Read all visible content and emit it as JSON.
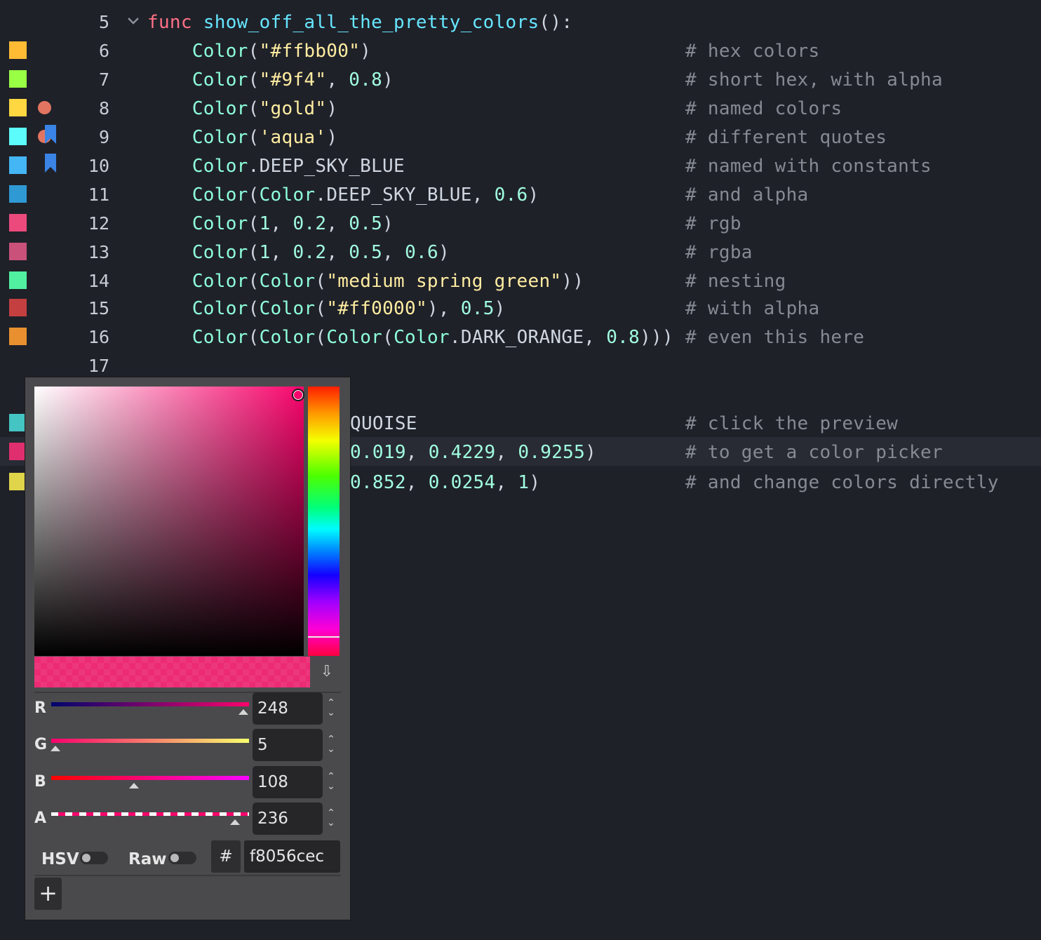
{
  "editor": {
    "lines": [
      {
        "num": "5",
        "code": [
          [
            "kw",
            "func"
          ],
          [
            "cs",
            " "
          ],
          [
            "fn",
            "show_off_all_the_pretty_colors"
          ],
          [
            "cs",
            "():"
          ]
        ],
        "comment": "",
        "swatch": ""
      },
      {
        "num": "6",
        "code": [
          [
            "cs",
            "    "
          ],
          [
            "cl",
            "Color"
          ],
          [
            "cs",
            "("
          ],
          [
            "st",
            "\"#ffbb00\""
          ],
          [
            "cs",
            ")"
          ]
        ],
        "comment": "# hex colors",
        "swatch": "#ffbb33"
      },
      {
        "num": "7",
        "code": [
          [
            "cs",
            "    "
          ],
          [
            "cl",
            "Color"
          ],
          [
            "cs",
            "("
          ],
          [
            "st",
            "\"#9f4\""
          ],
          [
            "cs",
            ", "
          ],
          [
            "nm",
            "0.8"
          ],
          [
            "cs",
            ")"
          ]
        ],
        "comment": "# short hex, with alpha",
        "swatch": "#99ff44"
      },
      {
        "num": "8",
        "code": [
          [
            "cs",
            "    "
          ],
          [
            "cl",
            "Color"
          ],
          [
            "cs",
            "("
          ],
          [
            "st",
            "\"gold\""
          ],
          [
            "cs",
            ")"
          ]
        ],
        "comment": "# named colors",
        "swatch": "#ffd740"
      },
      {
        "num": "9",
        "code": [
          [
            "cs",
            "    "
          ],
          [
            "cl",
            "Color"
          ],
          [
            "cs",
            "("
          ],
          [
            "st",
            "'aqua'"
          ],
          [
            "cs",
            ")"
          ]
        ],
        "comment": "# different quotes",
        "swatch": "#5cfcfc"
      },
      {
        "num": "10",
        "code": [
          [
            "cs",
            "    "
          ],
          [
            "cl",
            "Color"
          ],
          [
            "cs",
            ".DEEP_SKY_BLUE"
          ]
        ],
        "comment": "# named with constants",
        "swatch": "#44b6f6"
      },
      {
        "num": "11",
        "code": [
          [
            "cs",
            "    "
          ],
          [
            "cl",
            "Color"
          ],
          [
            "cs",
            "("
          ],
          [
            "cl",
            "Color"
          ],
          [
            "cs",
            ".DEEP_SKY_BLUE, "
          ],
          [
            "nm",
            "0.6"
          ],
          [
            "cs",
            ")"
          ]
        ],
        "comment": "# and alpha",
        "swatch": "#2e99d3"
      },
      {
        "num": "12",
        "code": [
          [
            "cs",
            "    "
          ],
          [
            "cl",
            "Color"
          ],
          [
            "cs",
            "("
          ],
          [
            "nm",
            "1"
          ],
          [
            "cs",
            ", "
          ],
          [
            "nm",
            "0.2"
          ],
          [
            "cs",
            ", "
          ],
          [
            "nm",
            "0.5"
          ],
          [
            "cs",
            ")"
          ]
        ],
        "comment": "# rgb",
        "swatch": "#ec4a7c"
      },
      {
        "num": "13",
        "code": [
          [
            "cs",
            "    "
          ],
          [
            "cl",
            "Color"
          ],
          [
            "cs",
            "("
          ],
          [
            "nm",
            "1"
          ],
          [
            "cs",
            ", "
          ],
          [
            "nm",
            "0.2"
          ],
          [
            "cs",
            ", "
          ],
          [
            "nm",
            "0.5"
          ],
          [
            "cs",
            ", "
          ],
          [
            "nm",
            "0.6"
          ],
          [
            "cs",
            ")"
          ]
        ],
        "comment": "# rgba",
        "swatch": "#c9517a"
      },
      {
        "num": "14",
        "code": [
          [
            "cs",
            "    "
          ],
          [
            "cl",
            "Color"
          ],
          [
            "cs",
            "("
          ],
          [
            "cl",
            "Color"
          ],
          [
            "cs",
            "("
          ],
          [
            "st",
            "\"medium spring green\""
          ],
          [
            "cs",
            "))"
          ]
        ],
        "comment": "# nesting",
        "swatch": "#51f0a0"
      },
      {
        "num": "15",
        "code": [
          [
            "cs",
            "    "
          ],
          [
            "cl",
            "Color"
          ],
          [
            "cs",
            "("
          ],
          [
            "cl",
            "Color"
          ],
          [
            "cs",
            "("
          ],
          [
            "st",
            "\"#ff0000\""
          ],
          [
            "cs",
            "), "
          ],
          [
            "nm",
            "0.5"
          ],
          [
            "cs",
            ")"
          ]
        ],
        "comment": "# with alpha",
        "swatch": "#c44040"
      },
      {
        "num": "16",
        "code": [
          [
            "cs",
            "    "
          ],
          [
            "cl",
            "Color"
          ],
          [
            "cs",
            "("
          ],
          [
            "cl",
            "Color"
          ],
          [
            "cs",
            "("
          ],
          [
            "cl",
            "Color"
          ],
          [
            "cs",
            "("
          ],
          [
            "cl",
            "Color"
          ],
          [
            "cs",
            ".DARK_ORANGE, "
          ],
          [
            "nm",
            "0.8"
          ],
          [
            "cs",
            ")))"
          ]
        ],
        "comment": "# even this here",
        "swatch": "#e8902f"
      },
      {
        "num": "17",
        "code": [],
        "comment": "",
        "swatch": ""
      },
      {
        "num": "",
        "code": [],
        "comment": "",
        "swatch": ""
      },
      {
        "num": "",
        "code": [
          [
            "cs",
            "QUOISE"
          ]
        ],
        "comment": "# click the preview",
        "swatch": "#45c4c4"
      },
      {
        "num": "",
        "code": [
          [
            "nm",
            "0.019"
          ],
          [
            "cs",
            ", "
          ],
          [
            "nm",
            "0.4229"
          ],
          [
            "cs",
            ", "
          ],
          [
            "nm",
            "0.9255"
          ],
          [
            "cs",
            ")"
          ]
        ],
        "comment": "# to get a color picker",
        "swatch": "#e02f6e"
      },
      {
        "num": "",
        "code": [
          [
            "nm",
            "0.852"
          ],
          [
            "cs",
            ", "
          ],
          [
            "nm",
            "0.0254"
          ],
          [
            "cs",
            ", "
          ],
          [
            "nm",
            "1"
          ],
          [
            "cs",
            ")"
          ]
        ],
        "comment": "# and change colors directly",
        "swatch": "#e0d44a"
      }
    ]
  },
  "picker": {
    "current_color": "#f8056c",
    "preview_color": "#ec2b74",
    "eyedropper_glyph": "⇩",
    "eyedropper_icon": "eyedropper-icon",
    "sliders": [
      {
        "label": "R",
        "value": "248",
        "level": 0.97
      },
      {
        "label": "G",
        "value": "5",
        "level": 0.02
      },
      {
        "label": "B",
        "value": "108",
        "level": 0.42
      },
      {
        "label": "A",
        "value": "236",
        "level": 0.93
      }
    ],
    "spin_arrows": "⌃\n⌄",
    "hsv_label": "HSV",
    "raw_label": "Raw",
    "hash_label": "#",
    "hex_value": "f8056cec",
    "add_label": "+"
  }
}
